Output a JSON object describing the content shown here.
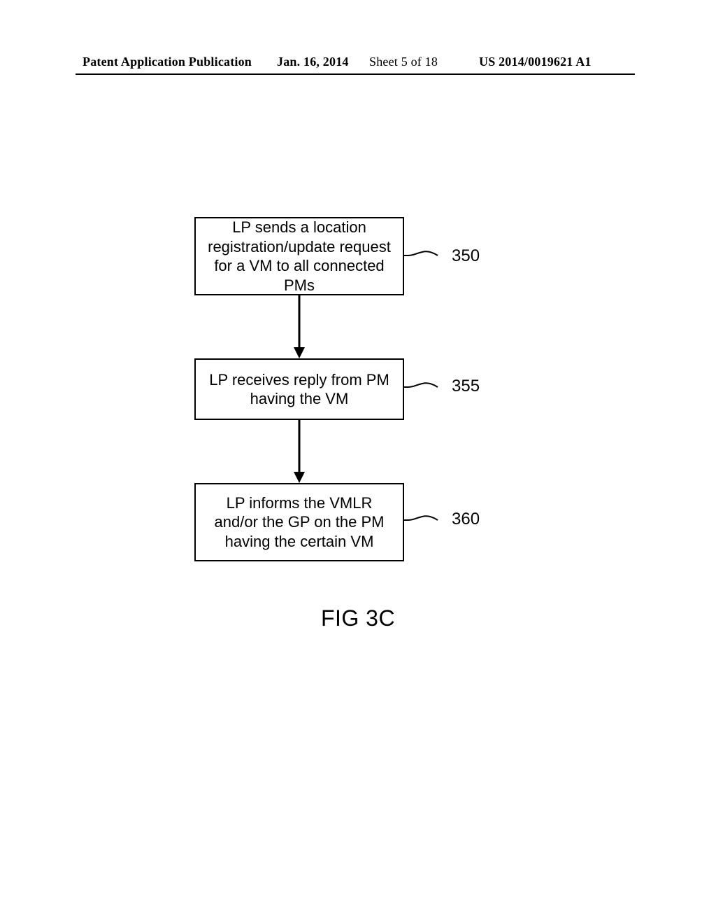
{
  "header": {
    "left": "Patent Application Publication",
    "date": "Jan. 16, 2014",
    "sheet": "Sheet 5 of 18",
    "pubno": "US 2014/0019621 A1"
  },
  "flow": {
    "steps": [
      {
        "ref": "350",
        "text": "LP sends a location registration/update request for a VM to all connected PMs"
      },
      {
        "ref": "355",
        "text": "LP receives reply from PM having the VM"
      },
      {
        "ref": "360",
        "text": "LP informs the VMLR and/or the GP on the PM having the certain VM"
      }
    ]
  },
  "figure_caption": "FIG 3C"
}
